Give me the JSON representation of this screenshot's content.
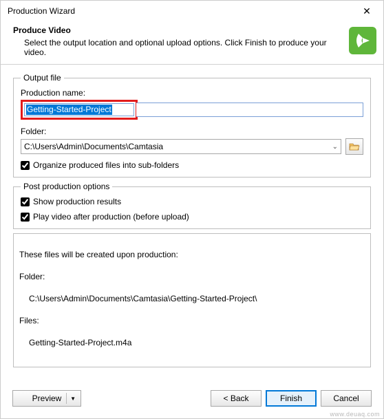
{
  "window": {
    "title": "Production Wizard",
    "close_glyph": "✕"
  },
  "header": {
    "title": "Produce Video",
    "subtitle": "Select the output location and optional upload options. Click Finish to produce your video."
  },
  "output_file": {
    "legend": "Output file",
    "production_name_label": "Production name:",
    "production_name_value": "Getting-Started-Project",
    "folder_label": "Folder:",
    "folder_value": "C:\\Users\\Admin\\Documents\\Camtasia",
    "organize_label": "Organize produced files into sub-folders",
    "organize_checked": true
  },
  "post_production": {
    "legend": "Post production options",
    "show_results_label": "Show production results",
    "show_results_checked": true,
    "play_video_label": "Play video after production (before upload)",
    "play_video_checked": true
  },
  "info_box": {
    "line1": "These files will be created upon production:",
    "line2": "Folder:",
    "line3": "C:\\Users\\Admin\\Documents\\Camtasia\\Getting-Started-Project\\",
    "line4": "Files:",
    "line5": "Getting-Started-Project.m4a"
  },
  "buttons": {
    "preview": "Preview",
    "back": "< Back",
    "finish": "Finish",
    "cancel": "Cancel"
  },
  "watermark": "www.deuaq.com"
}
